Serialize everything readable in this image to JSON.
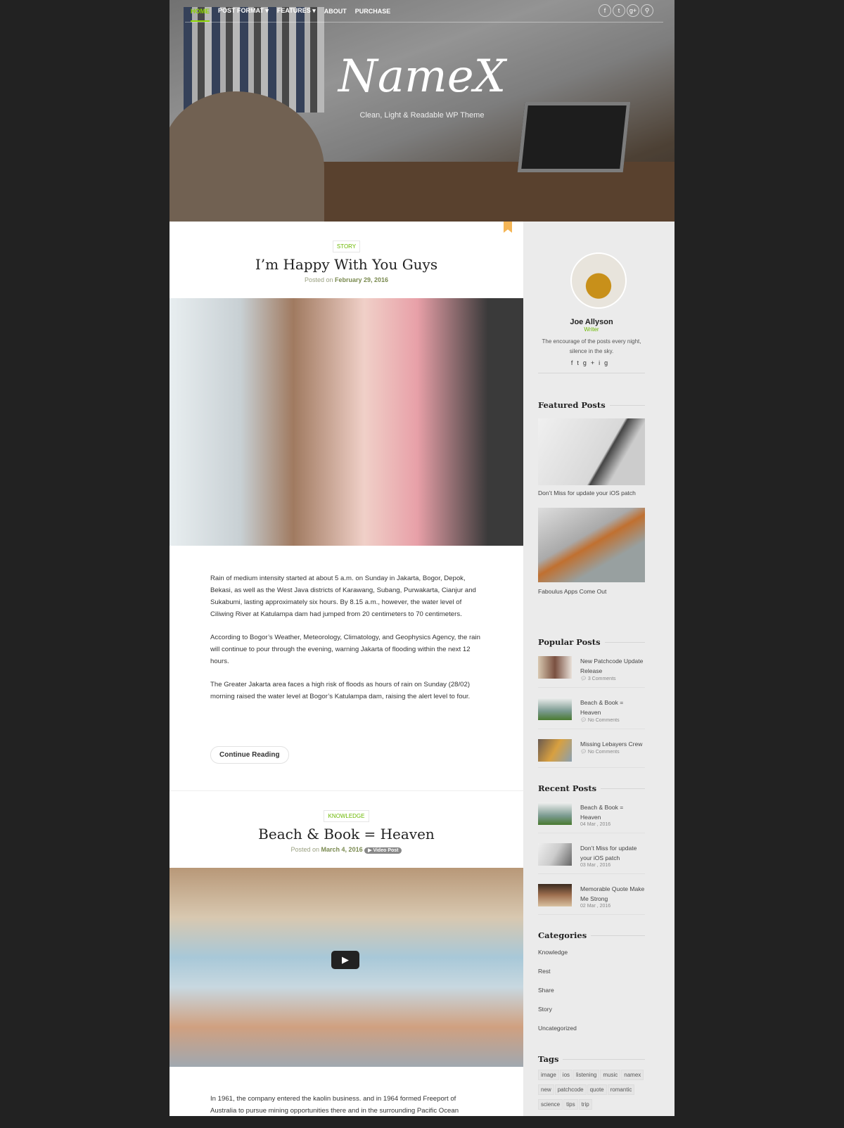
{
  "nav": {
    "items": [
      "HOME",
      "POST FORMAT",
      "FEATURES",
      "ABOUT",
      "PURCHASE"
    ],
    "accent": "#8bd400"
  },
  "social_icons": [
    "facebook-icon",
    "twitter-icon",
    "google-plus-icon",
    "search-icon"
  ],
  "brand": {
    "logo": "NameX",
    "tagline": "Clean, Light & Readable WP Theme"
  },
  "posts": [
    {
      "category": "STORY",
      "title": "I’m Happy With You Guys",
      "posted_on": "Posted on",
      "date": "February 29, 2016",
      "paragraphs": [
        "Rain of medium intensity started at about 5 a.m. on Sunday in Jakarta, Bogor, Depok, Bekasi, as well as the West Java districts of Karawang, Subang, Purwakarta, Cianjur and Sukabumi, lasting approximately six hours. By 8.15 a.m., however, the water level of Ciliwing River at Katulampa dam had jumped from 20 centimeters to 70 centimeters.",
        "According to Bogor’s Weather, Meteorology, Climatology, and Geophysics Agency, the rain will continue to pour through the evening, warning Jakarta of flooding within the next 12 hours.",
        "The Greater Jakarta area faces a high risk of floods as hours of rain on Sunday (28/02) morning raised the water level at Bogor’s Katulampa dam, raising the alert level to four."
      ],
      "continue": "Continue Reading"
    },
    {
      "category": "KNOWLEDGE",
      "title": "Beach & Book = Heaven",
      "posted_on": "Posted on",
      "date": "March 4, 2016",
      "badge": "▶ Video Post",
      "paragraphs": [
        "In 1961, the company entered the kaolin business. and in 1964 formed Freeport of Australia to pursue mining opportunities there and in the surrounding Pacific Ocean"
      ]
    }
  ],
  "author": {
    "name": "Joe Allyson",
    "role": "Writer",
    "bio": "The encourage of the posts every night, silence in the sky.",
    "icons": [
      "f",
      "t",
      "g+",
      "ig"
    ]
  },
  "featured": {
    "heading": "Featured Posts",
    "items": [
      "Don’t Miss for update your iOS patch",
      "Faboulus Apps Come Out"
    ]
  },
  "popular": {
    "heading": "Popular Posts",
    "items": [
      {
        "title": "New Patchcode Update Release",
        "meta": "3 Comments"
      },
      {
        "title": "Beach & Book = Heaven",
        "meta": "No Comments"
      },
      {
        "title": "Missing Lebayers Crew",
        "meta": "No Comments"
      }
    ]
  },
  "recent": {
    "heading": "Recent Posts",
    "items": [
      {
        "title": "Beach & Book = Heaven",
        "meta": "04 Mar , 2016"
      },
      {
        "title": "Don’t Miss for update your iOS patch",
        "meta": "03 Mar , 2016"
      },
      {
        "title": "Memorable Quote Make Me Strong",
        "meta": "02 Mar , 2016"
      }
    ]
  },
  "categories": {
    "heading": "Categories",
    "items": [
      "Knowledge",
      "Rest",
      "Share",
      "Story",
      "Uncategorized"
    ]
  },
  "tags": {
    "heading": "Tags",
    "items": [
      "image",
      "ios",
      "listening",
      "music",
      "namex",
      "new",
      "patchcode",
      "quote",
      "romantic",
      "science",
      "tips",
      "trip"
    ]
  }
}
